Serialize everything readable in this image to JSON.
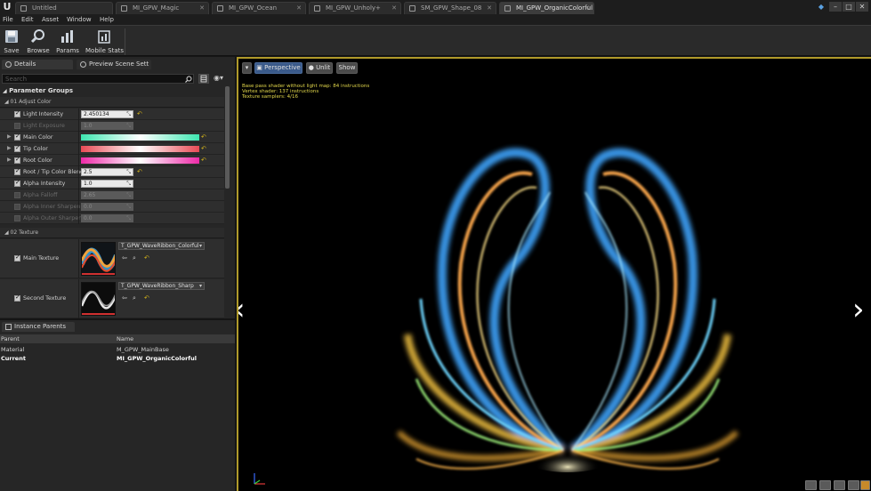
{
  "tabs": [
    {
      "label": "Untitled"
    },
    {
      "label": "MI_GPW_Magic"
    },
    {
      "label": "MI_GPW_Ocean"
    },
    {
      "label": "MI_GPW_Unholy+"
    },
    {
      "label": "SM_GPW_Shape_08"
    },
    {
      "label": "MI_GPW_OrganicColorful"
    }
  ],
  "menu": [
    "File",
    "Edit",
    "Asset",
    "Window",
    "Help"
  ],
  "toolbar": {
    "save": "Save",
    "browse": "Browse",
    "params": "Params",
    "mobile_stats": "Mobile Stats"
  },
  "details_panel": {
    "tab_details": "Details",
    "tab_preview": "Preview Scene Sett",
    "search_placeholder": "Search",
    "parameter_groups": "Parameter Groups",
    "group_adjust_color": "01 Adjust Color",
    "group_texture": "02 Texture",
    "rows": [
      {
        "label": "Light Intensity",
        "value": "2.450134"
      },
      {
        "label": "Light Exposure",
        "value": "1.0"
      },
      {
        "label": "Main Color",
        "color": "#3ee6b0"
      },
      {
        "label": "Tip Color",
        "color": "#e84a55"
      },
      {
        "label": "Root Color",
        "color": "#ee2aa8"
      },
      {
        "label": "Root / Tip Color Blend",
        "value": "2.5"
      },
      {
        "label": "Alpha Intensity",
        "value": "1.0"
      },
      {
        "label": "Alpha Falloff",
        "value": "2.65"
      },
      {
        "label": "Alpha Inner Sharpen",
        "value": "0.0"
      },
      {
        "label": "Alpha Outer Sharpen",
        "value": "0.0"
      }
    ],
    "textures": [
      {
        "label": "Main Texture",
        "asset": "T_GPW_WaveRibbon_Colorful"
      },
      {
        "label": "Second Texture",
        "asset": "T_GPW_WaveRibbon_Sharp"
      }
    ]
  },
  "instance_parents": {
    "tab": "Instance Parents",
    "col_parent": "Parent",
    "col_name": "Name",
    "rows": [
      {
        "parent": "Material",
        "name": "M_GPW_MainBase"
      },
      {
        "parent": "Current",
        "name": "MI_GPW_OrganicColorful"
      }
    ]
  },
  "viewport": {
    "perspective": "Perspective",
    "lit": "Unlit",
    "show": "Show",
    "stats": [
      "Base pass shader without light map: 84 instructions",
      "Vertex shader: 137 instructions",
      "Texture samplers: 4/16"
    ],
    "nav_prev": "‹",
    "nav_next": "›"
  }
}
